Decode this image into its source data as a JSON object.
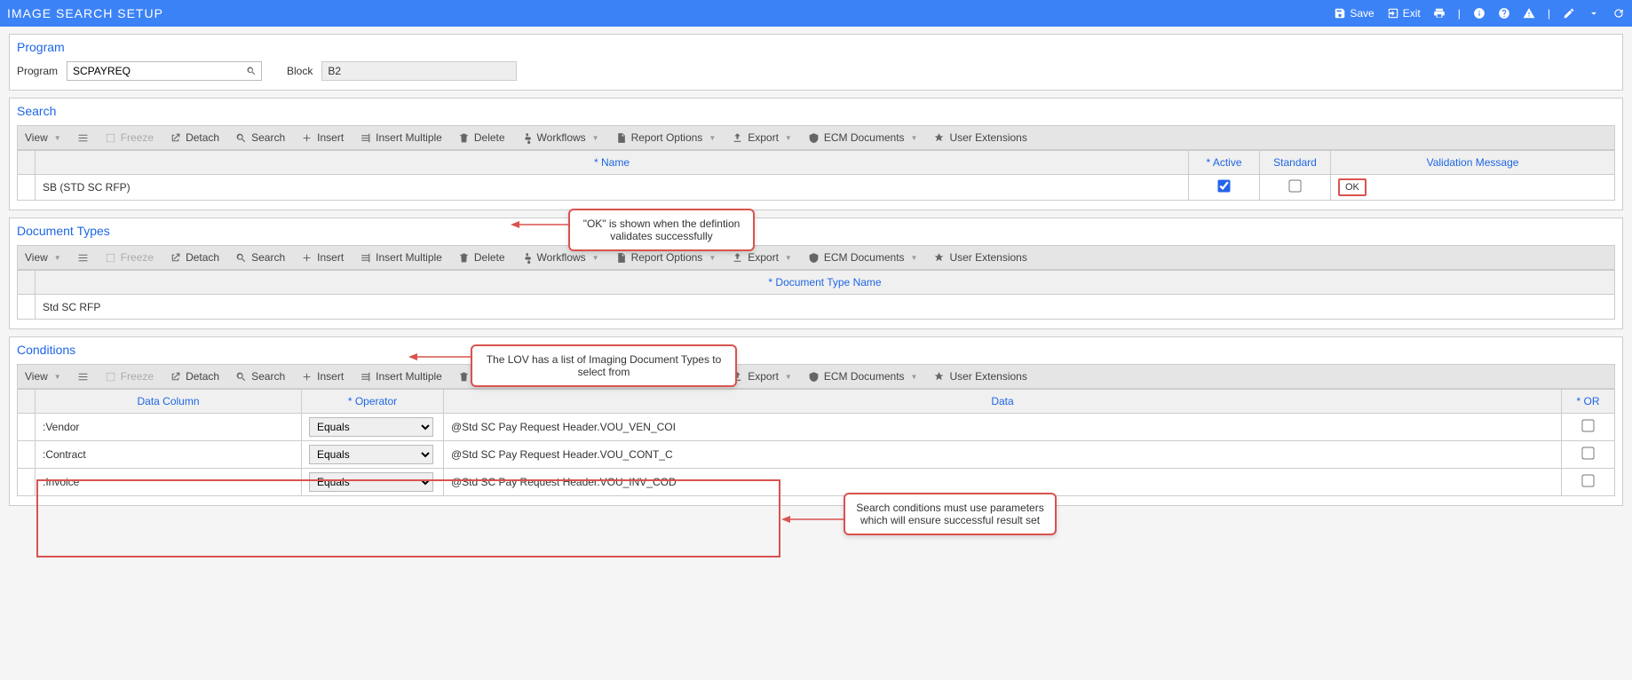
{
  "header": {
    "title": "IMAGE SEARCH SETUP",
    "actions": {
      "save": "Save",
      "exit": "Exit"
    }
  },
  "program_section": {
    "title": "Program",
    "program_label": "Program",
    "program_value": "SCPAYREQ",
    "block_label": "Block",
    "block_value": "B2"
  },
  "toolbar": {
    "view": "View",
    "freeze": "Freeze",
    "detach": "Detach",
    "search": "Search",
    "insert": "Insert",
    "insert_multiple": "Insert Multiple",
    "delete": "Delete",
    "workflows": "Workflows",
    "report_options": "Report Options",
    "export": "Export",
    "ecm_documents": "ECM Documents",
    "user_extensions": "User Extensions"
  },
  "search_section": {
    "title": "Search",
    "columns": {
      "name": "* Name",
      "active": "* Active",
      "standard": "Standard",
      "validation": "Validation Message"
    },
    "row": {
      "name": "SB (STD SC RFP)",
      "active": true,
      "standard": false,
      "validation": "OK"
    }
  },
  "doctype_section": {
    "title": "Document Types",
    "columns": {
      "name": "* Document Type Name"
    },
    "row": {
      "name": "Std SC RFP"
    }
  },
  "conditions_section": {
    "title": "Conditions",
    "columns": {
      "data_column": "Data Column",
      "operator": "* Operator",
      "data": "Data",
      "or": "* OR"
    },
    "rows": [
      {
        "data_column": ":Vendor",
        "operator": "Equals",
        "data": "@Std SC Pay Request Header.VOU_VEN_COI",
        "or": false
      },
      {
        "data_column": ":Contract",
        "operator": "Equals",
        "data": "@Std SC Pay Request Header.VOU_CONT_C",
        "or": false
      },
      {
        "data_column": ":Invoice",
        "operator": "Equals",
        "data": "@Std SC Pay Request Header.VOU_INV_COD",
        "or": false
      }
    ]
  },
  "callouts": {
    "ok": "\"OK\" is shown when the defintion validates successfully",
    "lov": "The LOV has a list of Imaging Document Types to select from",
    "cond": "Search conditions must use parameters which will ensure successful result set"
  }
}
